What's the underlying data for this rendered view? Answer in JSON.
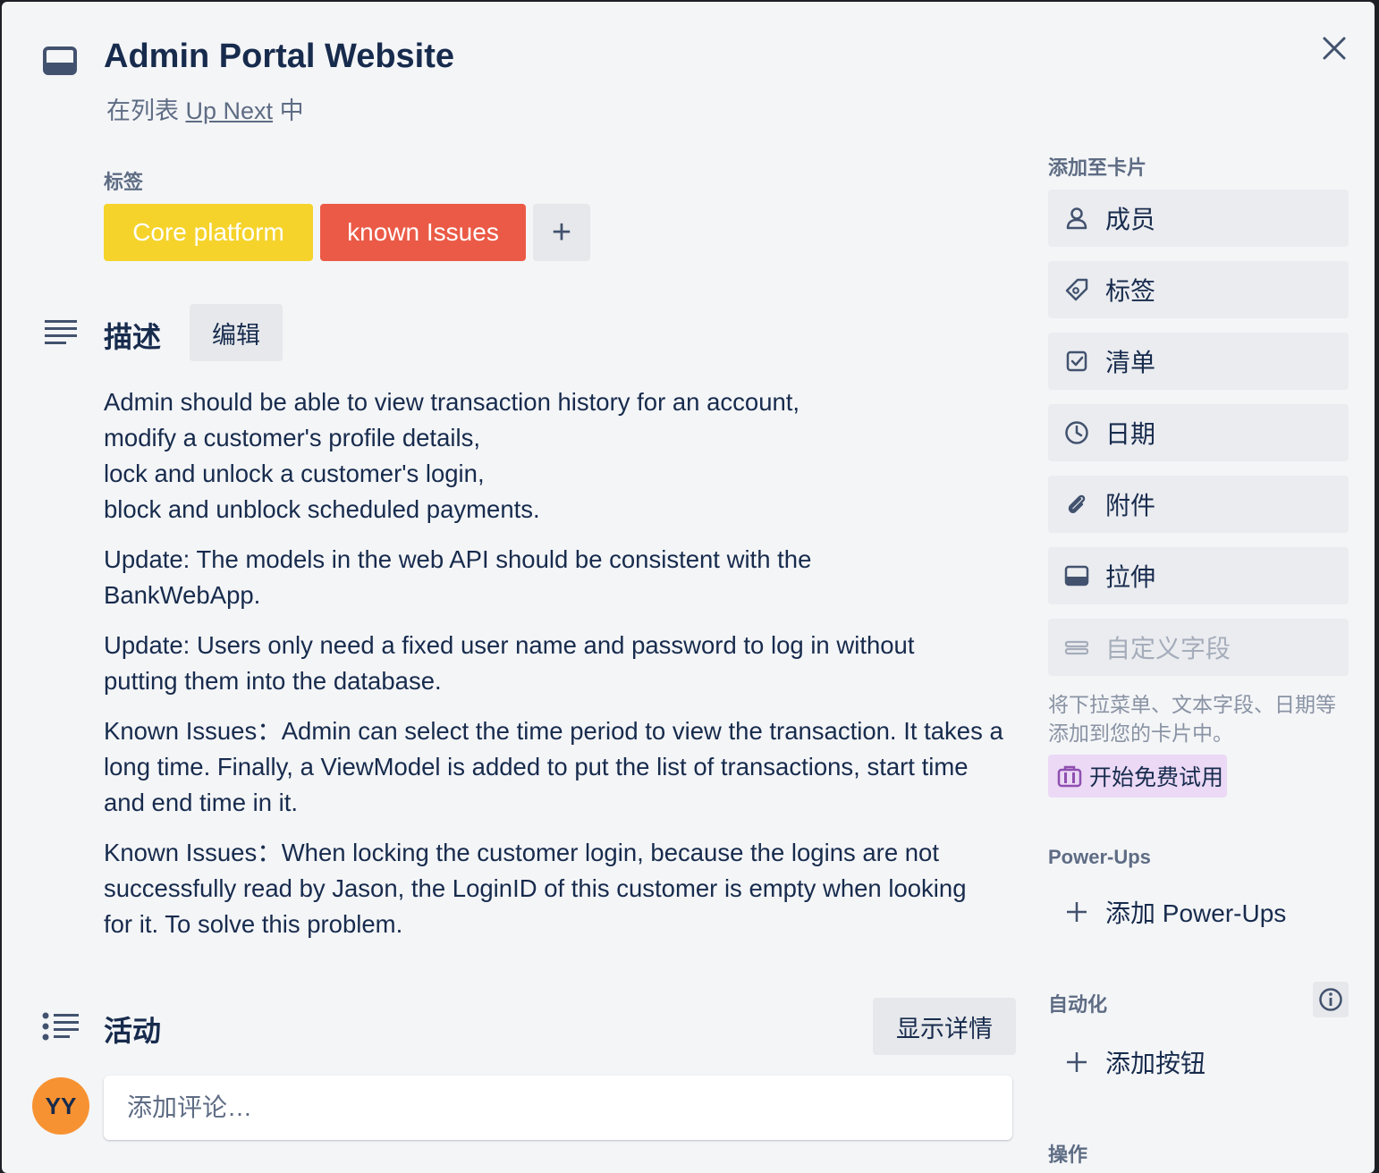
{
  "card": {
    "title": "Admin Portal Website",
    "list_prefix": "在列表 ",
    "list_name": "Up Next",
    "list_suffix": " 中"
  },
  "labels_section": {
    "heading": "标签",
    "labels": [
      {
        "text": "Core platform",
        "color": "#f5d32b"
      },
      {
        "text": "known Issues",
        "color": "#eb5a46"
      }
    ],
    "add_symbol": "+"
  },
  "description": {
    "heading": "描述",
    "edit_label": "编辑",
    "paragraphs": [
      [
        "Admin should be able to view transaction history for an account,",
        "modify a customer's profile details,",
        "lock and unlock a customer's login,",
        "block and unblock scheduled payments."
      ],
      [
        "Update: The models in the web API should be consistent with the BankWebApp."
      ],
      [
        "Update: Users only need a fixed user name and password to log in without putting them into the database."
      ],
      [
        "Known Issues：Admin can select the time period to view the transaction. It takes a long time. Finally, a ViewModel is added to put the list of transactions, start time and end time in it."
      ],
      [
        "Known Issues：When locking the customer login, because the logins are not successfully read by Jason, the LoginID of this customer is empty when looking for it. To solve this problem."
      ]
    ]
  },
  "activity": {
    "heading": "活动",
    "show_details_label": "显示详情",
    "avatar_initials": "YY",
    "avatar_color": "#f79232",
    "comment_placeholder": "添加评论…"
  },
  "sidebar": {
    "add_to_card_heading": "添加至卡片",
    "buttons": [
      {
        "label": "成员",
        "icon": "person-icon"
      },
      {
        "label": "标签",
        "icon": "tag-icon"
      },
      {
        "label": "清单",
        "icon": "checklist-icon"
      },
      {
        "label": "日期",
        "icon": "clock-icon"
      },
      {
        "label": "附件",
        "icon": "paperclip-icon"
      },
      {
        "label": "拉伸",
        "icon": "cover-icon"
      },
      {
        "label": "自定义字段",
        "icon": "custom-field-icon"
      }
    ],
    "custom_fields_hint": "将下拉菜单、文本字段、日期等添加到您的卡片中。",
    "trial_label": "开始免费试用",
    "powerups_heading": "Power-Ups",
    "add_powerups_label": "添加 Power-Ups",
    "automation_heading": "自动化",
    "add_button_label": "添加按钮",
    "actions_heading": "操作"
  },
  "colors": {
    "background": "#f4f5f7",
    "button_bg": "#ebecf0",
    "text": "#172b4d",
    "muted_text": "#5e6c84",
    "trial_bg": "#ebd9f5",
    "trial_icon": "#8f4fb0"
  }
}
